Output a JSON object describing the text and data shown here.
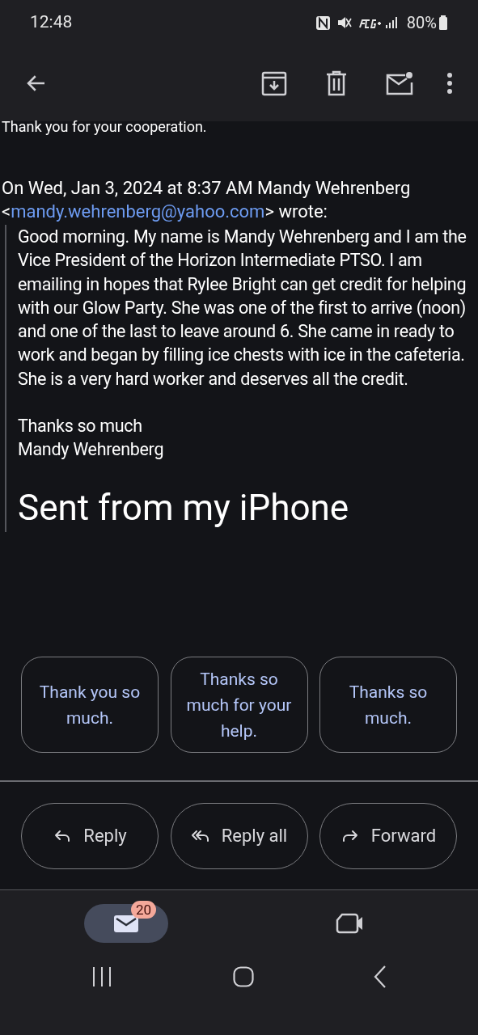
{
  "status_bar": {
    "time": "12:48",
    "battery": "80%"
  },
  "message": {
    "previous_line": "Thank you for your cooperation.",
    "attribution_before": "On Wed, Jan 3, 2024 at 8:37 AM Mandy Wehrenberg <",
    "attribution_email": "mandy.wehrenberg@yahoo.com",
    "attribution_after": "> wrote:",
    "quote_paragraphs": [
      "Good morning. My name is Mandy Wehrenberg and I am the Vice President of the Horizon Intermediate PTSO. I am emailing in hopes that Rylee Bright can get credit for helping with our Glow Party. She was one of the first to arrive (noon) and one of the last to leave around 6. She came in ready to work and began by filling ice chests with ice in the cafeteria. She is a very hard worker and deserves all the credit.",
      "Thanks so much\nMandy Wehrenberg"
    ],
    "signature": "Sent from my iPhone"
  },
  "smart_replies": [
    "Thank you so much.",
    "Thanks so much for your help.",
    "Thanks so much."
  ],
  "actions": [
    {
      "kind": "reply",
      "label": "Reply"
    },
    {
      "kind": "reply_all",
      "label": "Reply all"
    },
    {
      "kind": "forward",
      "label": "Forward"
    }
  ],
  "bottom_nav": [
    {
      "kind": "mail",
      "selected": true,
      "badge": "20"
    },
    {
      "kind": "meet",
      "selected": false
    }
  ]
}
